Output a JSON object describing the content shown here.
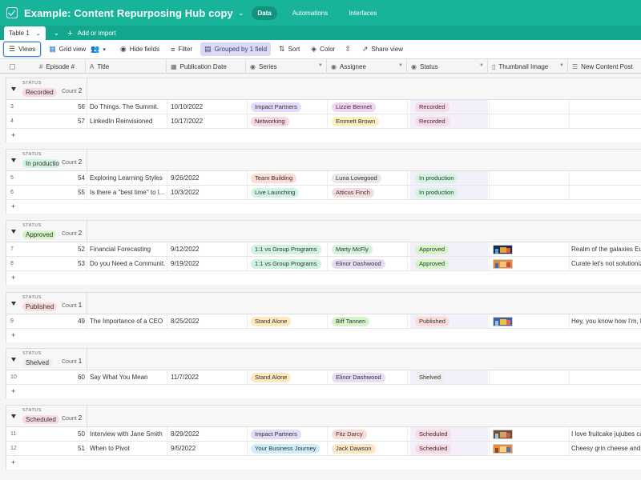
{
  "header": {
    "title": "Example: Content Repurposing Hub copy",
    "nav": [
      {
        "label": "Data",
        "active": true
      },
      {
        "label": "Automations",
        "active": false
      },
      {
        "label": "Interfaces",
        "active": false
      }
    ]
  },
  "tablebar": {
    "table_name": "Table 1",
    "add_import": "Add or import"
  },
  "toolbar": {
    "views": "Views",
    "grid_view": "Grid view",
    "hide_fields": "Hide fields",
    "filter": "Filter",
    "grouped": "Grouped by 1 field",
    "sort": "Sort",
    "color": "Color",
    "share_view": "Share view"
  },
  "columns": {
    "episode": "Episode #",
    "title": "Title",
    "pub_date": "Publication Date",
    "series": "Series",
    "assignee": "Assignee",
    "status": "Status",
    "thumbnail": "Thumbnail Image",
    "new_post": "New Content Post"
  },
  "groups": [
    {
      "field_label": "STATUS",
      "value": "Recorded",
      "count_label": "Count",
      "count": "2",
      "rows": [
        {
          "rownum": "3",
          "episode": "56",
          "title": "Do Things. The Summit.",
          "date": "10/10/2022",
          "series": "Impact Partners",
          "assignee": "Lizzie Bennet",
          "status": "Recorded",
          "post": ""
        },
        {
          "rownum": "4",
          "episode": "57",
          "title": "LinkedIn Reinvisioned",
          "date": "10/17/2022",
          "series": "Networking",
          "assignee": "Emmett Brown",
          "status": "Recorded",
          "post": ""
        }
      ]
    },
    {
      "field_label": "STATUS",
      "value": "In production",
      "count_label": "Count",
      "count": "2",
      "rows": [
        {
          "rownum": "5",
          "episode": "54",
          "title": "Exploring Learning Styles",
          "date": "9/26/2022",
          "series": "Team Building",
          "assignee": "Luna Lovegood",
          "status": "In production",
          "post": ""
        },
        {
          "rownum": "6",
          "episode": "55",
          "title": "Is there a \"best time\" to l...",
          "date": "10/3/2022",
          "series": "Live Launching",
          "assignee": "Atticus Finch",
          "status": "In production",
          "post": ""
        }
      ]
    },
    {
      "field_label": "STATUS",
      "value": "Approved",
      "count_label": "Count",
      "count": "2",
      "rows": [
        {
          "rownum": "7",
          "episode": "52",
          "title": "Financial Forecasting",
          "date": "9/12/2022",
          "series": "1:1 vs Group Programs",
          "assignee": "Marty McFly",
          "status": "Approved",
          "post": "Realm of the galaxies Euc..."
        },
        {
          "rownum": "8",
          "episode": "53",
          "title": "Do you Need a Communit...",
          "date": "9/19/2022",
          "series": "1:1 vs Group Programs",
          "assignee": "Elinor Dashwood",
          "status": "Approved",
          "post": "Curate let's not solutioniz..."
        }
      ]
    },
    {
      "field_label": "STATUS",
      "value": "Published",
      "count_label": "Count",
      "count": "1",
      "rows": [
        {
          "rownum": "9",
          "episode": "49",
          "title": "The Importance of a CEO ...",
          "date": "8/25/2022",
          "series": "Stand Alone",
          "assignee": "Biff Tannen",
          "status": "Published",
          "post": "Hey, you know how I'm, li..."
        }
      ]
    },
    {
      "field_label": "STATUS",
      "value": "Shelved",
      "count_label": "Count",
      "count": "1",
      "rows": [
        {
          "rownum": "10",
          "episode": "60",
          "title": "Say What You Mean",
          "date": "11/7/2022",
          "series": "Stand Alone",
          "assignee": "Elinor Dashwood",
          "status": "Shelved",
          "post": ""
        }
      ]
    },
    {
      "field_label": "STATUS",
      "value": "Scheduled",
      "count_label": "Count",
      "count": "2",
      "rows": [
        {
          "rownum": "11",
          "episode": "50",
          "title": "Interview with Jane Smith",
          "date": "8/29/2022",
          "series": "Impact Partners",
          "assignee": "Fitz Darcy",
          "status": "Scheduled",
          "post": "I love fruitcake jujubes ca..."
        },
        {
          "rownum": "12",
          "episode": "51",
          "title": "When to Pivot",
          "date": "9/5/2022",
          "series": "Your Business Journey",
          "assignee": "Jack Dawson",
          "status": "Scheduled",
          "post": "Cheesy grin cheese and ..."
        }
      ]
    }
  ],
  "colors": {
    "header_bg": "#17b49a",
    "status": {
      "Recorded": "#f8d9e8",
      "In production": "#d2f5e2",
      "Approved": "#d6f5c9",
      "Published": "#fbdcd6",
      "Shelved": "#eeeeee",
      "Scheduled": "#f9d9e3"
    },
    "series": {
      "Impact Partners": "#e3d9f8",
      "Networking": "#f9d6e3",
      "Team Building": "#fcdcd4",
      "Live Launching": "#d2f4e6",
      "1:1 vs Group Programs": "#cff2e1",
      "Stand Alone": "#fde8bf",
      "Your Business Journey": "#cfeefa"
    },
    "assignee": {
      "Lizzie Bennet": "#f1d5f3",
      "Emmett Brown": "#fbefc2",
      "Luna Lovegood": "#e8e8e8",
      "Atticus Finch": "#f8dde0",
      "Marty McFly": "#d3f3de",
      "Elinor Dashwood": "#e6def4",
      "Biff Tannen": "#d6f4c9",
      "Fitz Darcy": "#fbdcd6",
      "Jack Dawson": "#fde6c4"
    }
  },
  "icons": {
    "base": "checkbox-icon",
    "views": "hamburger-icon",
    "grid": "grid-icon",
    "hide": "eye-slash-icon",
    "filter": "filter-icon",
    "group": "group-icon",
    "sort": "sort-icon",
    "color": "paint-bucket-icon",
    "row_height": "row-height-icon",
    "share": "share-icon"
  }
}
